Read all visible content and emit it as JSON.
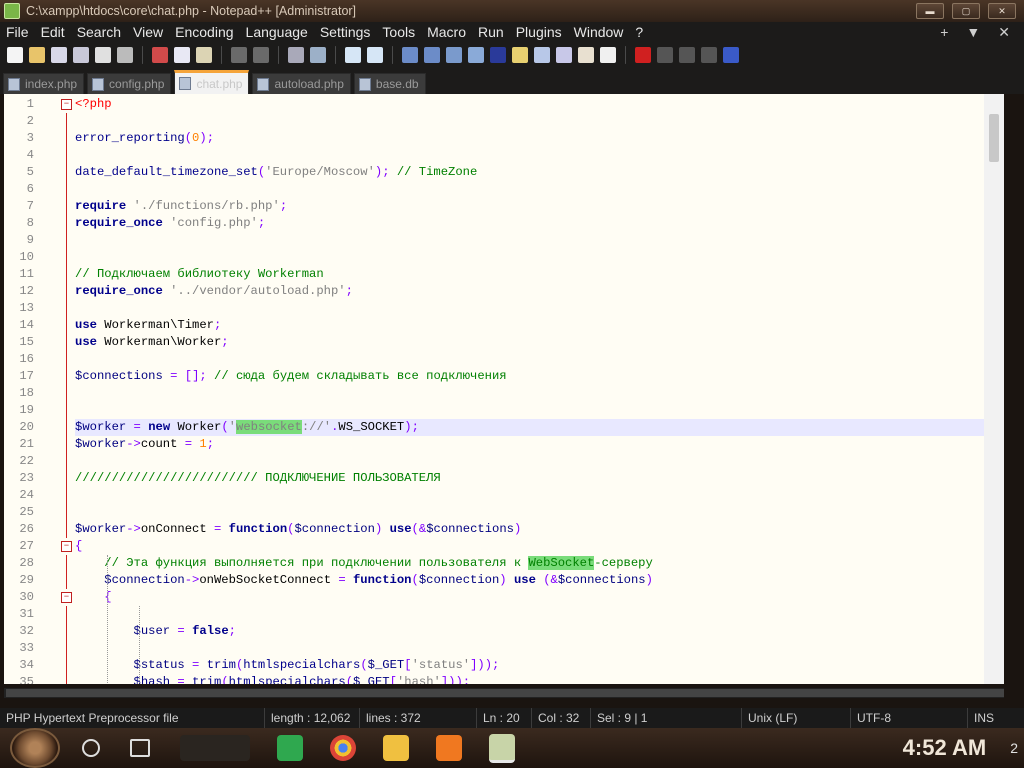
{
  "window": {
    "title": "C:\\xampp\\htdocs\\core\\chat.php - Notepad++ [Administrator]",
    "min_label": "▬",
    "max_label": "▢",
    "close_label": "✕"
  },
  "menu": {
    "items": [
      "File",
      "Edit",
      "Search",
      "View",
      "Encoding",
      "Language",
      "Settings",
      "Tools",
      "Macro",
      "Run",
      "Plugins",
      "Window",
      "?"
    ],
    "right": [
      "+",
      "▼",
      "✕"
    ]
  },
  "tabs": [
    {
      "label": "index.php",
      "active": false
    },
    {
      "label": "config.php",
      "active": false
    },
    {
      "label": "chat.php",
      "active": true
    },
    {
      "label": "autoload.php",
      "active": false
    },
    {
      "label": "base.db",
      "active": false
    }
  ],
  "editor": {
    "current_line": 20,
    "lines": [
      {
        "n": "1",
        "html": "<span class=\"php\">&lt;?php</span>"
      },
      {
        "n": "2",
        "html": ""
      },
      {
        "n": "3",
        "html": "<span class=\"fn\">error_reporting</span><span class=\"op\">(</span><span class=\"num\">0</span><span class=\"op\">);</span>"
      },
      {
        "n": "4",
        "html": ""
      },
      {
        "n": "5",
        "html": "<span class=\"fn\">date_default_timezone_set</span><span class=\"op\">(</span><span class=\"str\">'Europe/Moscow'</span><span class=\"op\">);</span> <span class=\"cmt\">// TimeZone</span>"
      },
      {
        "n": "6",
        "html": ""
      },
      {
        "n": "7",
        "html": "<span class=\"kw\">require</span> <span class=\"str\">'./functions/rb.php'</span><span class=\"op\">;</span>"
      },
      {
        "n": "8",
        "html": "<span class=\"kw\">require_once</span> <span class=\"str\">'config.php'</span><span class=\"op\">;</span>"
      },
      {
        "n": "9",
        "html": ""
      },
      {
        "n": "10",
        "html": ""
      },
      {
        "n": "11",
        "html": "<span class=\"cmt\">// Подключаем библиотеку Workerman</span>"
      },
      {
        "n": "12",
        "html": "<span class=\"kw\">require_once</span> <span class=\"str\">'../vendor/autoload.php'</span><span class=\"op\">;</span>"
      },
      {
        "n": "13",
        "html": ""
      },
      {
        "n": "14",
        "html": "<span class=\"kw\">use</span> Workerman\\Timer<span class=\"op\">;</span>"
      },
      {
        "n": "15",
        "html": "<span class=\"kw\">use</span> Workerman\\Worker<span class=\"op\">;</span>"
      },
      {
        "n": "16",
        "html": ""
      },
      {
        "n": "17",
        "html": "<span class=\"var\">$connections</span> <span class=\"op\">=</span> <span class=\"op\">[];</span> <span class=\"cmt\">// сюда будем складывать все подключения</span>"
      },
      {
        "n": "18",
        "html": ""
      },
      {
        "n": "19",
        "html": ""
      },
      {
        "n": "20",
        "html": "<span class=\"var\">$worker</span> <span class=\"op\">=</span> <span class=\"kw\">new</span> Worker<span class=\"op\">(</span><span class=\"str\">'<span class=\"hl\">websocket</span>://'</span><span class=\"op\">.</span>WS_SOCKET<span class=\"op\">);</span>"
      },
      {
        "n": "21",
        "html": "<span class=\"var\">$worker</span><span class=\"op\">-&gt;</span>count <span class=\"op\">=</span> <span class=\"num\">1</span><span class=\"op\">;</span>"
      },
      {
        "n": "22",
        "html": ""
      },
      {
        "n": "23",
        "html": "<span class=\"cmt\">///////////////////////// ПОДКЛЮЧЕНИЕ ПОЛЬЗОВАТЕЛЯ</span>"
      },
      {
        "n": "24",
        "html": ""
      },
      {
        "n": "25",
        "html": ""
      },
      {
        "n": "26",
        "html": "<span class=\"var\">$worker</span><span class=\"op\">-&gt;</span>onConnect <span class=\"op\">=</span> <span class=\"kw\">function</span><span class=\"op\">(</span><span class=\"var\">$connection</span><span class=\"op\">)</span> <span class=\"kw\">use</span><span class=\"op\">(&amp;</span><span class=\"var\">$connections</span><span class=\"op\">)</span>"
      },
      {
        "n": "27",
        "html": "<span class=\"op\">{</span>"
      },
      {
        "n": "28",
        "html": "    <span class=\"cmt\">// Эта функция выполняется при подключении пользователя к <span class=\"hl\">WebSocket</span>-серверу</span>"
      },
      {
        "n": "29",
        "html": "    <span class=\"var\">$connection</span><span class=\"op\">-&gt;</span>onWebSocketConnect <span class=\"op\">=</span> <span class=\"kw\">function</span><span class=\"op\">(</span><span class=\"var\">$connection</span><span class=\"op\">)</span> <span class=\"kw\">use</span> <span class=\"op\">(&amp;</span><span class=\"var\">$connections</span><span class=\"op\">)</span>"
      },
      {
        "n": "30",
        "html": "    <span class=\"op\">{</span>"
      },
      {
        "n": "31",
        "html": ""
      },
      {
        "n": "32",
        "html": "        <span class=\"var\">$user</span> <span class=\"op\">=</span> <span class=\"kw\">false</span><span class=\"op\">;</span>"
      },
      {
        "n": "33",
        "html": ""
      },
      {
        "n": "34",
        "html": "        <span class=\"var\">$status</span> <span class=\"op\">=</span> <span class=\"fn\">trim</span><span class=\"op\">(</span><span class=\"fn\">htmlspecialchars</span><span class=\"op\">(</span><span class=\"var\">$_GET</span><span class=\"op\">[</span><span class=\"str\">'status'</span><span class=\"op\">]));</span>"
      },
      {
        "n": "35",
        "html": "        <span class=\"var\">$hash</span> <span class=\"op\">=</span> <span class=\"fn\">trim</span><span class=\"op\">(</span><span class=\"fn\">htmlspecialchars</span><span class=\"op\">(</span><span class=\"var\">$_GET</span><span class=\"op\">[</span><span class=\"str\">'hash'</span><span class=\"op\">]));</span>"
      }
    ]
  },
  "status": {
    "file_type": "PHP Hypertext Preprocessor file",
    "length": "length : 12,062",
    "lines": "lines : 372",
    "ln": "Ln : 20",
    "col": "Col : 32",
    "sel": "Sel : 9 | 1",
    "eol": "Unix (LF)",
    "encoding": "UTF-8",
    "mode": "INS"
  },
  "taskbar": {
    "clock": "4:52 AM",
    "notification_count": "2"
  }
}
